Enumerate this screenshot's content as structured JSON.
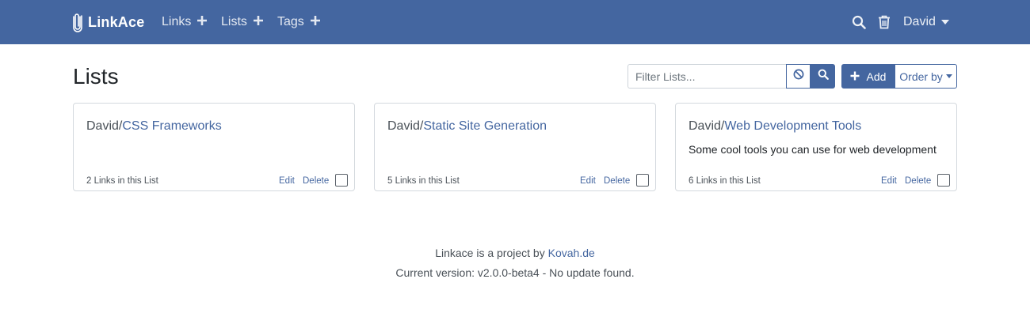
{
  "navbar": {
    "brand": "LinkAce",
    "items": [
      {
        "label": "Links"
      },
      {
        "label": "Lists"
      },
      {
        "label": "Tags"
      }
    ],
    "user": "David"
  },
  "page": {
    "title": "Lists",
    "filter": {
      "placeholder": "Filter Lists...",
      "value": ""
    },
    "add_label": "Add",
    "order_label": "Order by"
  },
  "lists": [
    {
      "owner": "David/",
      "name": "CSS Frameworks",
      "description": "",
      "count": "2 Links in this List",
      "edit": "Edit",
      "delete": "Delete",
      "checked": false
    },
    {
      "owner": "David/",
      "name": "Static Site Generation",
      "description": "",
      "count": "5 Links in this List",
      "edit": "Edit",
      "delete": "Delete",
      "checked": false
    },
    {
      "owner": "David/",
      "name": "Web Development Tools",
      "description": "Some cool tools you can use for web development",
      "count": "6 Links in this List",
      "edit": "Edit",
      "delete": "Delete",
      "checked": false
    }
  ],
  "footer": {
    "project_text": "Linkace is a project by",
    "project_link": "Kovah.de",
    "version_text": "Current version: v2.0.0-beta4 - No update found."
  },
  "colors": {
    "primary": "#4466a0",
    "navbar_bg": "#4466a0",
    "card_border": "#d4d9de"
  },
  "icons": {
    "brand": "paperclip-icon",
    "nav_add": "plus-icon",
    "search": "search-icon",
    "trash": "trash-icon",
    "clear": "ban-icon",
    "add": "plus-icon"
  }
}
